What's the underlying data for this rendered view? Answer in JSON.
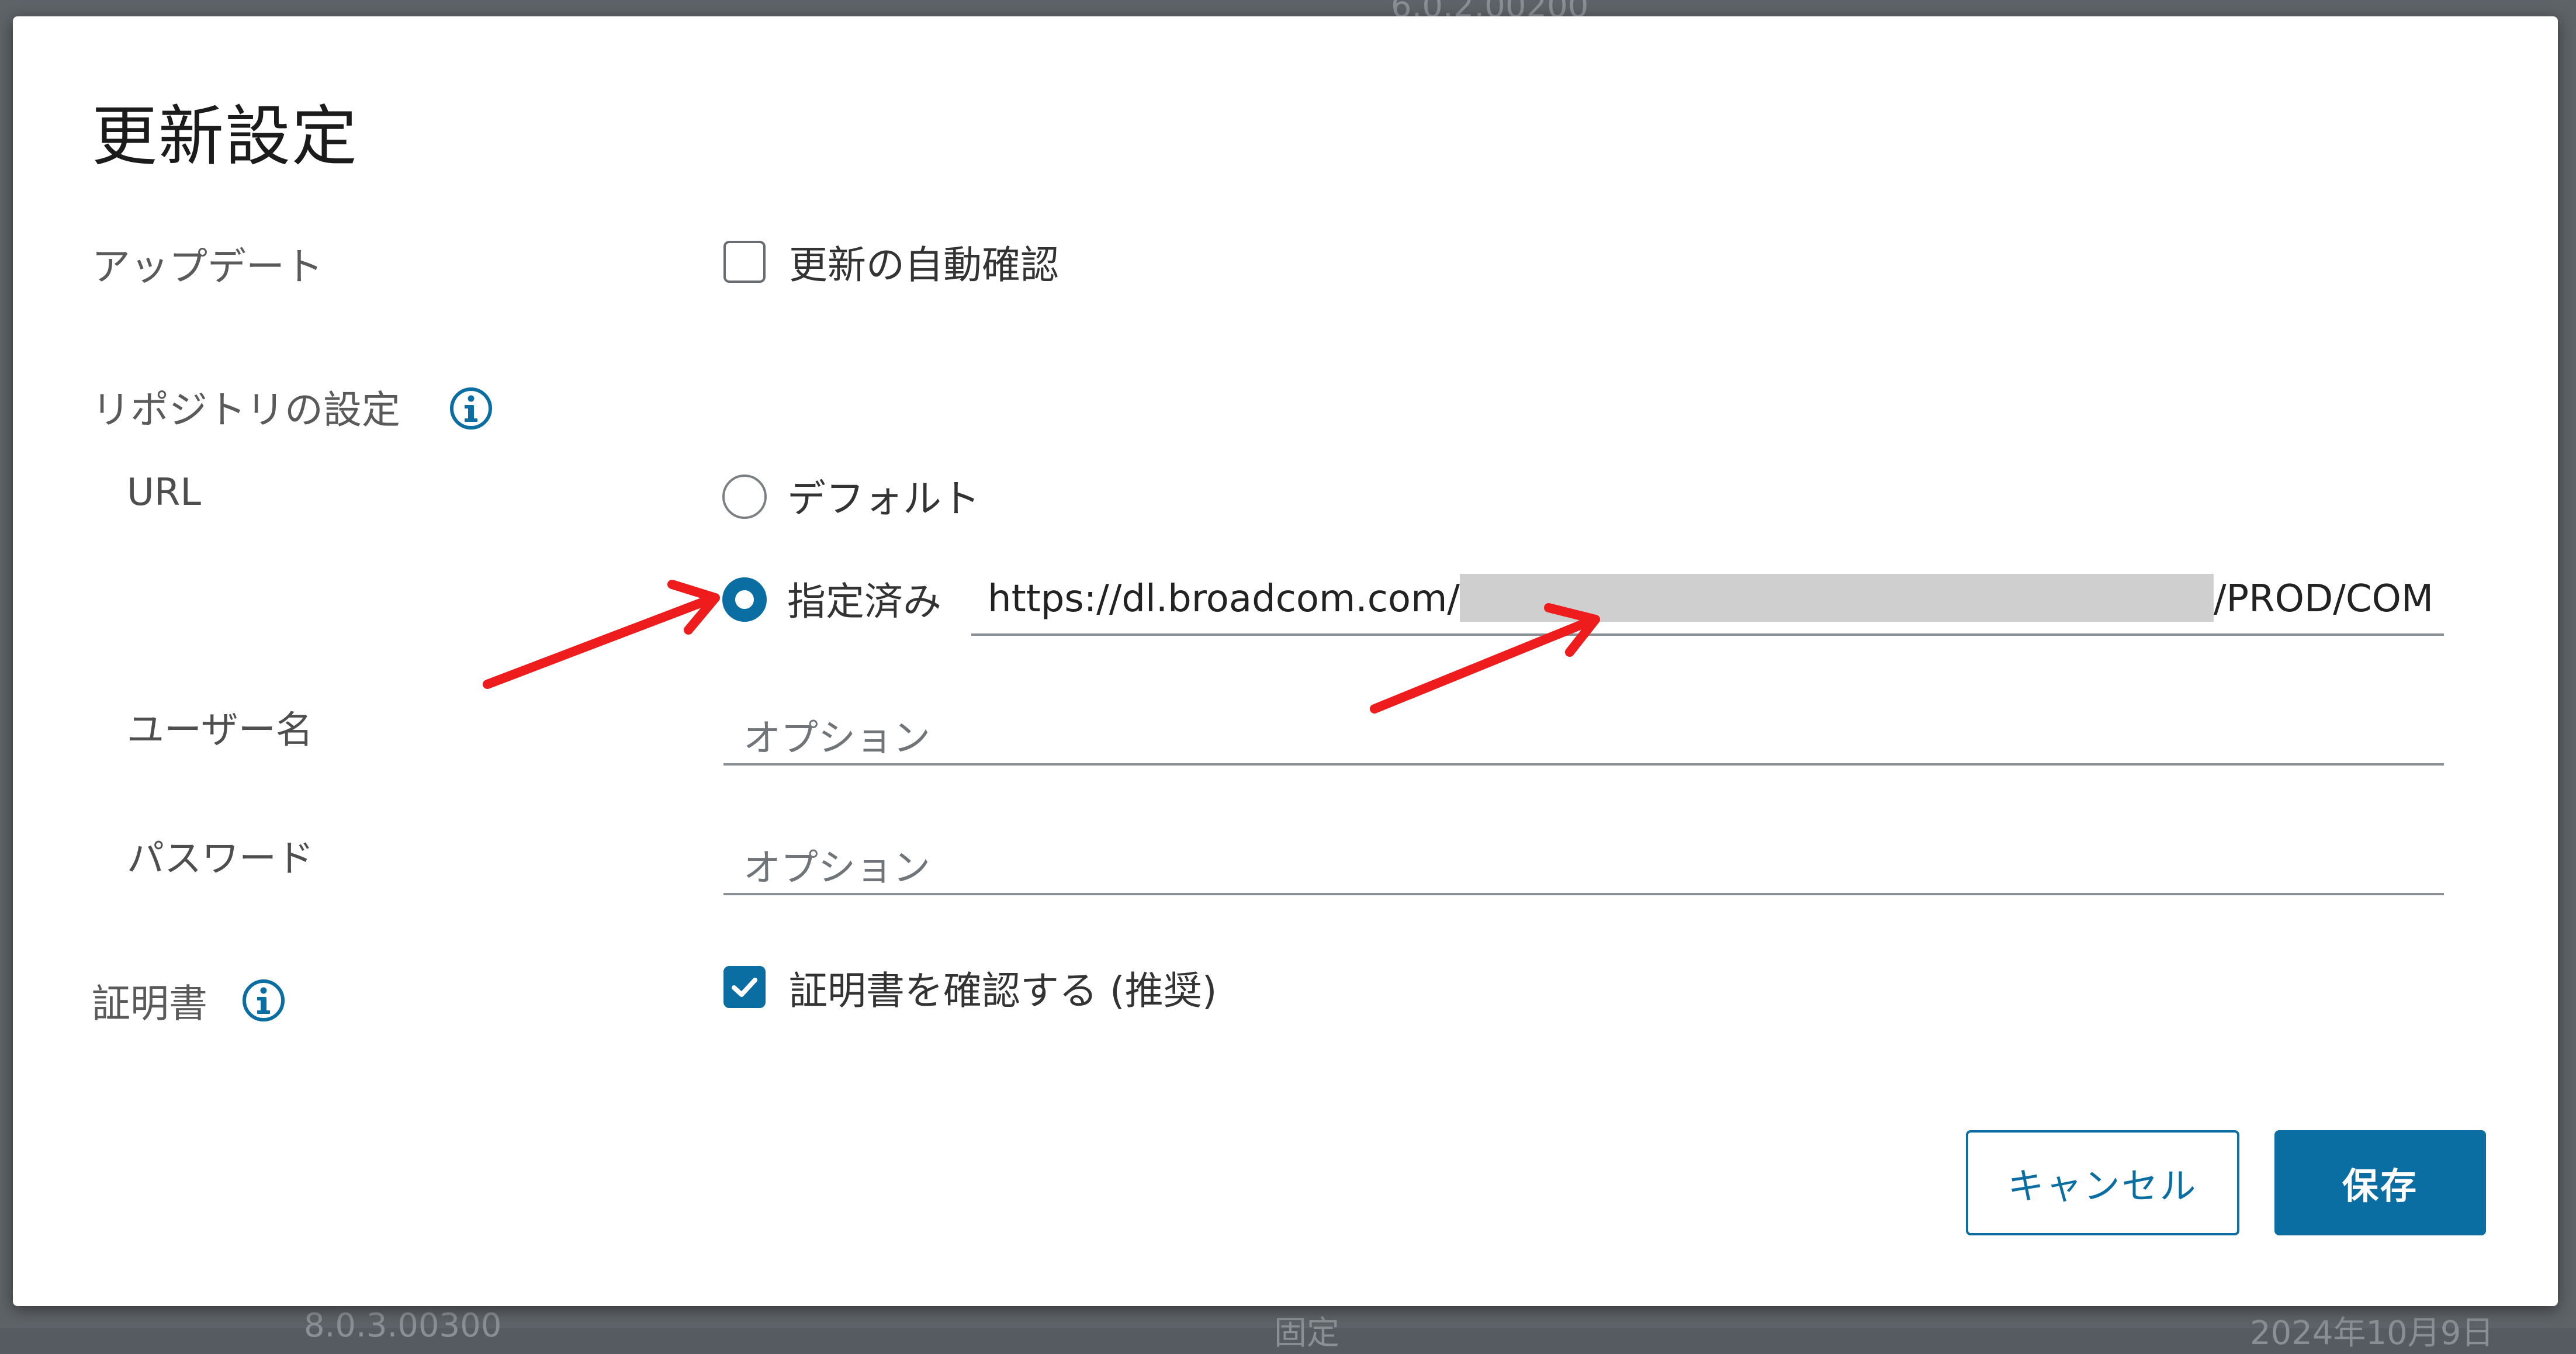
{
  "background": {
    "top_text": "6.0.2.00200",
    "bottom_left_text": "8.0.3.00300",
    "bottom_mid_text": "固定",
    "bottom_right_text": "2024年10月9日"
  },
  "dialog": {
    "title": "更新設定",
    "update": {
      "label": "アップデート",
      "auto_check_label": "更新の自動確認",
      "auto_check_checked": false
    },
    "repository": {
      "label": "リポジトリの設定",
      "url_label": "URL",
      "option_default_label": "デフォルト",
      "option_specified_label": "指定済み",
      "selected_option": "specified",
      "url_prefix": "https://dl.broadcom.com/",
      "url_suffix": "/PROD/COM",
      "username_label": "ユーザー名",
      "username_placeholder": "オプション",
      "password_label": "パスワード",
      "password_placeholder": "オプション"
    },
    "certificate": {
      "label": "証明書",
      "verify_label": "証明書を確認する (推奨)",
      "verify_checked": true
    },
    "buttons": {
      "cancel": "キャンセル",
      "save": "保存"
    }
  },
  "colors": {
    "accent": "#0b6ea2",
    "annotation_arrow": "#ee1c1c"
  },
  "icons": {
    "repository_info": "info-icon",
    "certificate_info": "info-icon",
    "checkmark": "check-icon"
  }
}
